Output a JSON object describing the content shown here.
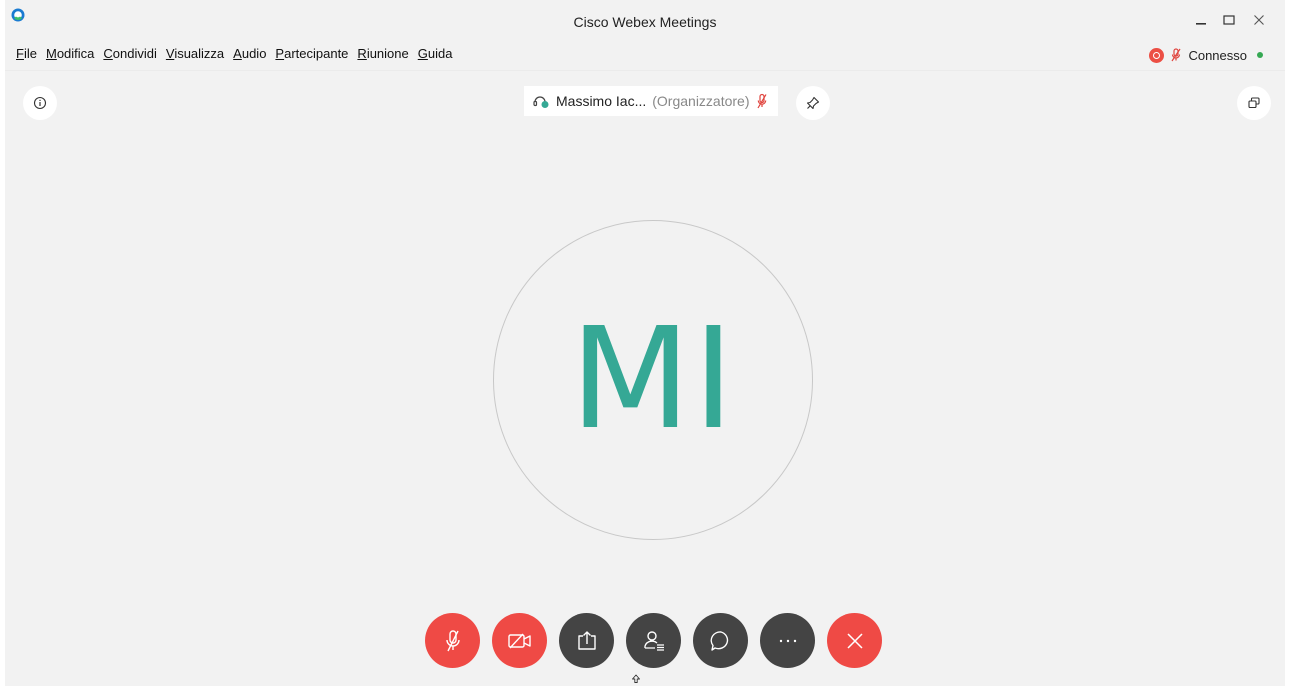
{
  "window": {
    "title": "Cisco Webex Meetings"
  },
  "menu": [
    {
      "underline": "F",
      "rest": "ile"
    },
    {
      "underline": "M",
      "rest": "odifica"
    },
    {
      "underline": "C",
      "rest": "ondividi"
    },
    {
      "underline": "V",
      "rest": "isualizza"
    },
    {
      "underline": "A",
      "rest": "udio"
    },
    {
      "underline": "P",
      "rest": "artecipante"
    },
    {
      "underline": "R",
      "rest": "iunione"
    },
    {
      "underline": "G",
      "pre": "",
      "rest": "uida"
    }
  ],
  "status": {
    "connection": "Connesso"
  },
  "participant": {
    "name": "Massimo Iac...",
    "role": "(Organizzatore)",
    "initials": "MI"
  },
  "colors": {
    "accent_red": "#ef4a45",
    "dark_button": "#444444",
    "avatar_green": "#35a895",
    "connected_green": "#35a853"
  },
  "icons": {
    "info": "info-icon",
    "pin": "pin-icon",
    "layout": "layout-switch-icon",
    "mute": "mic-muted-icon",
    "video": "video-off-icon",
    "share": "share-icon",
    "participants": "participants-icon",
    "chat": "chat-icon",
    "more": "more-icon",
    "end": "close-icon"
  }
}
